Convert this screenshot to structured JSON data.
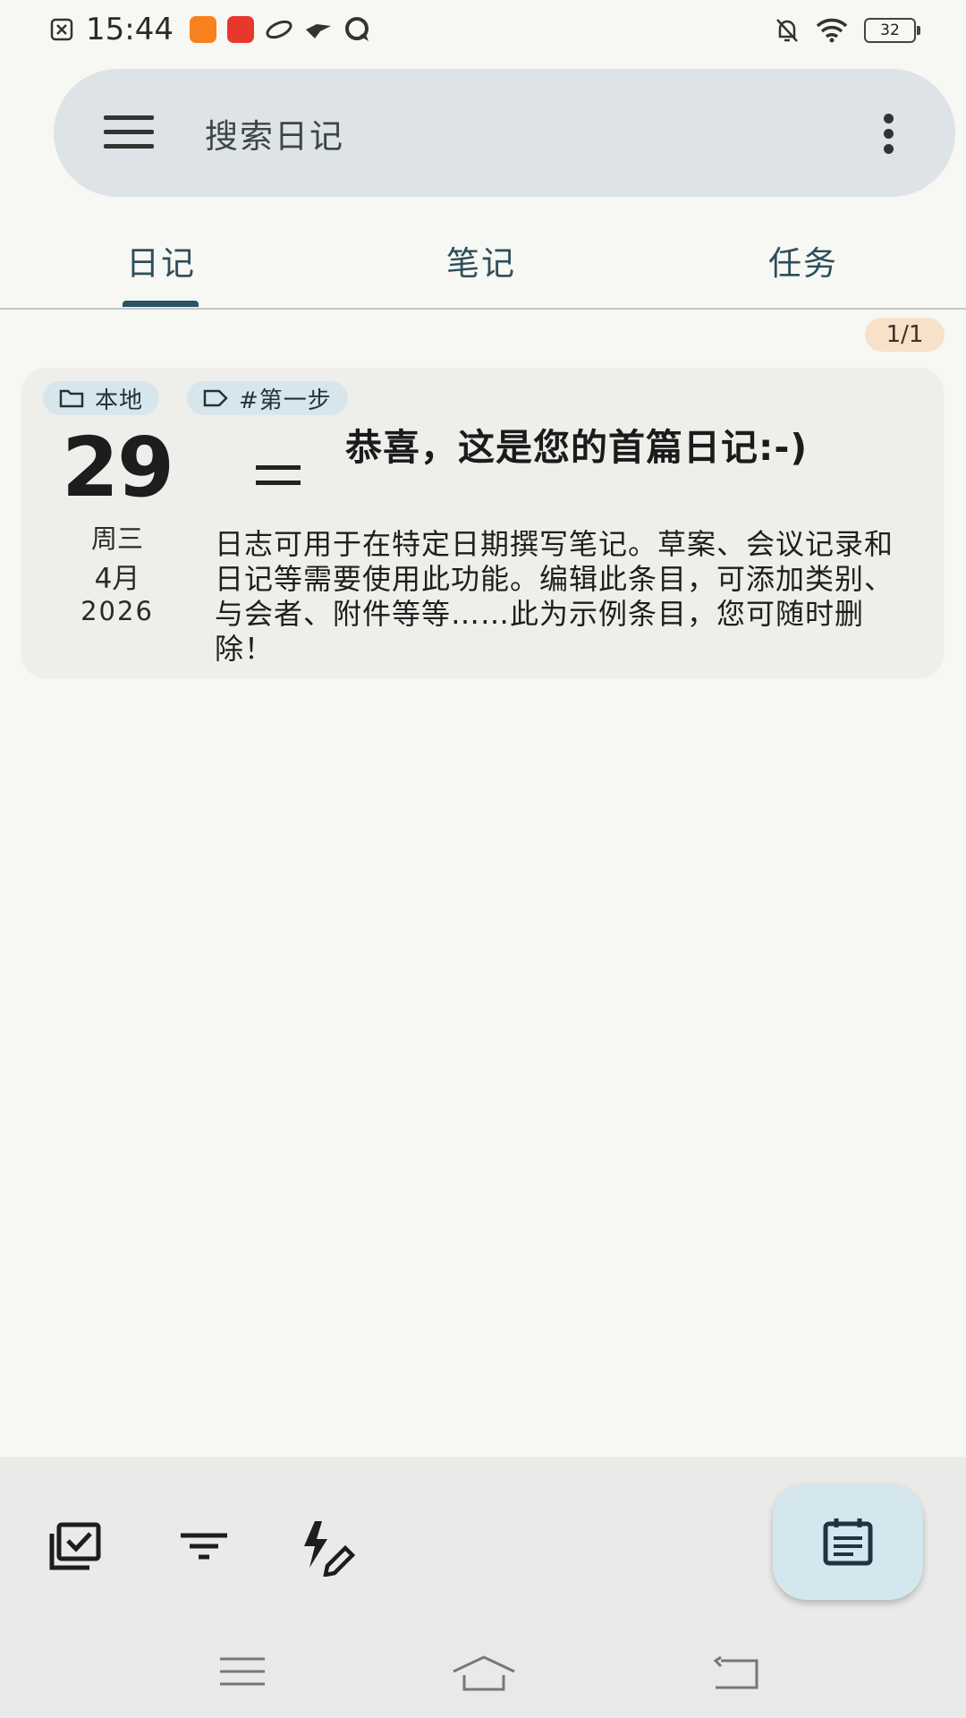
{
  "status_bar": {
    "time": "15:44",
    "battery_level": "32",
    "icons": [
      "notification-close-icon",
      "taobao-app-icon",
      "pinduoduo-app-icon",
      "planet-app-icon",
      "bird-app-icon",
      "chat-app-icon",
      "bell-off-icon",
      "wifi-icon",
      "battery-icon"
    ]
  },
  "search": {
    "placeholder": "搜索日记"
  },
  "tabs": [
    {
      "label": "日记",
      "selected": true
    },
    {
      "label": "笔记",
      "selected": false
    },
    {
      "label": "任务",
      "selected": false
    }
  ],
  "counter": "1/1",
  "entry": {
    "collection": "本地",
    "category": "#第一步",
    "day": "29",
    "weekday": "周三",
    "month": "4月",
    "year": "2026",
    "title": "恭喜，这是您的首篇日记:-)",
    "body": "日志可用于在特定日期撰写笔记。草案、会议记录和日记等需要使用此功能。编辑此条目，可添加类别、与会者、附件等等……此为示例条目，您可随时删除！"
  },
  "bottom_bar": {
    "actions": [
      "select-all-icon",
      "filter-icon",
      "quick-edit-icon"
    ],
    "fab": "new-journal-icon"
  },
  "nav_bar": [
    "recents-icon",
    "home-icon",
    "back-icon"
  ],
  "colors": {
    "background": "#f7f7f3",
    "search_bg": "#dde3e6",
    "tab_text": "#2d4e5d",
    "chip_bg": "#d6e6ec",
    "counter_bg": "#f7e1c8",
    "fab_bg": "#d5e7ee"
  }
}
